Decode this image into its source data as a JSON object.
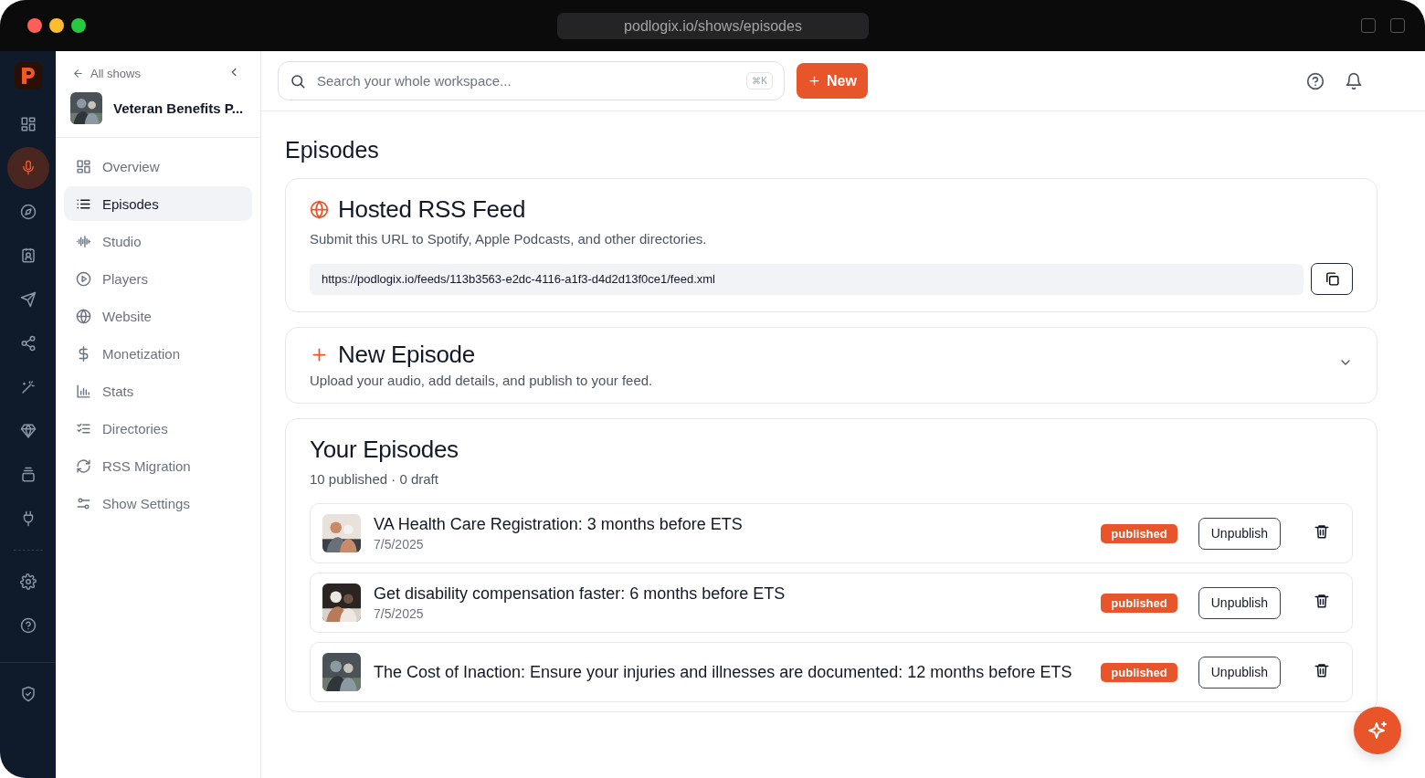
{
  "browser": {
    "url": "podlogix.io/shows/episodes"
  },
  "rail": {
    "items": [
      {
        "selected": false
      },
      {
        "selected": true
      },
      {
        "selected": false
      },
      {
        "selected": false
      },
      {
        "selected": false
      },
      {
        "selected": false
      },
      {
        "selected": false
      },
      {
        "selected": false
      },
      {
        "selected": false
      },
      {
        "selected": false
      }
    ],
    "bottom_items": [
      {
        "selected": false
      },
      {
        "selected": false
      }
    ],
    "footer_items": [
      {
        "selected": false
      }
    ]
  },
  "sidebar": {
    "back_link": "All shows",
    "show_title": "Veteran Benefits P...",
    "items": [
      {
        "label": "Overview",
        "selected": false
      },
      {
        "label": "Episodes",
        "selected": true
      },
      {
        "label": "Studio",
        "selected": false
      },
      {
        "label": "Players",
        "selected": false
      },
      {
        "label": "Website",
        "selected": false
      },
      {
        "label": "Monetization",
        "selected": false
      },
      {
        "label": "Stats",
        "selected": false
      },
      {
        "label": "Directories",
        "selected": false
      },
      {
        "label": "RSS Migration",
        "selected": false
      },
      {
        "label": "Show Settings",
        "selected": false
      }
    ]
  },
  "top_bar": {
    "search": {
      "placeholder": "Search your whole workspace...",
      "shortcut": "⌘K"
    },
    "new_button": "New"
  },
  "page_title": "Episodes",
  "rss_feed": {
    "title": "Hosted RSS Feed",
    "description": "Submit this URL to Spotify, Apple Podcasts, and other directories.",
    "url": "https://podlogix.io/feeds/113b3563-e2dc-4116-a1f3-d4d2d13f0ce1/feed.xml"
  },
  "new_episode": {
    "title": "New Episode",
    "description": "Upload your audio, add details, and publish to your feed.",
    "expanded": false
  },
  "your_episodes": {
    "title": "Your Episodes",
    "summary": "10 published · 0 draft",
    "episodes": [
      {
        "title": "VA Health Care Registration: 3 months before ETS",
        "date": "7/5/2025",
        "status": "published",
        "action": "Unpublish"
      },
      {
        "title": "Get disability compensation faster: 6 months before ETS",
        "date": "7/5/2025",
        "status": "published",
        "action": "Unpublish"
      },
      {
        "title": "The Cost of Inaction: Ensure your injuries and illnesses are documented: 12 months before ETS",
        "status": "published",
        "action": "Unpublish"
      }
    ]
  }
}
